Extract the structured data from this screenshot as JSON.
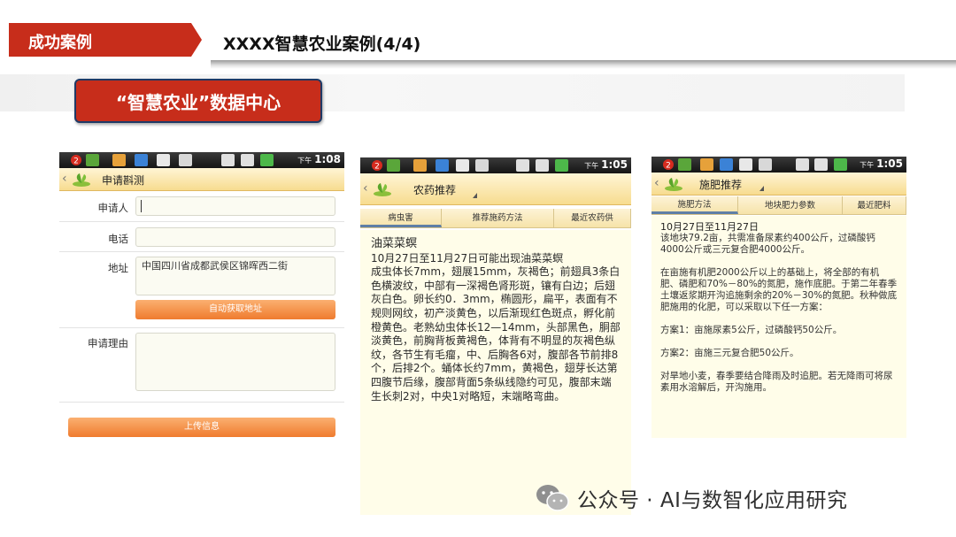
{
  "header": {
    "tag": "成功案例",
    "title": "XXXX智慧农业案例(4/4)",
    "colors": {
      "tag": "#c72d1b",
      "box_border": "#1f3a66"
    }
  },
  "data_center_label": "“智慧农业”数据中心",
  "status_bar": {
    "badge": "2",
    "am_pm": "下午",
    "time_1": "1:08",
    "time_2": "1:05",
    "time_3": "1:05"
  },
  "screen1": {
    "title": "申请斟测",
    "fields": {
      "applicant_label": "申请人",
      "applicant_value": "",
      "phone_label": "电话",
      "phone_value": "",
      "address_label": "地址",
      "address_value": "中国四川省成都武侯区锦晖西二街",
      "reason_label": "申请理由",
      "reason_value": ""
    },
    "auto_address_button": "自动获取地址",
    "upload_button": "上传信息"
  },
  "screen2": {
    "title": "农药推荐",
    "tabs": [
      "病虫害",
      "推荐施药方法",
      "最近农药供"
    ],
    "heading": "油菜菜螟",
    "content": "10月27日至11月27日可能出现油菜菜螟\n成虫体长7mm，翅展15mm，灰褐色；前翅具3条白色横波纹，中部有一深褐色肾形斑，镶有白边；后翅灰白色。卵长约0．3mm，椭圆形，扁平，表面有不规则网纹，初产淡黄色，以后渐现红色斑点，孵化前橙黄色。老熟幼虫体长12—14mm，头部黑色，胴部淡黄色，前胸背板黄褐色，体背有不明显的灰褐色纵纹，各节生有毛瘤，中、后胸各6对，腹部各节前排8个，后排2个。蛹体长约7mm，黄褐色，翅芽长达第四腹节后缘，腹部背面5条纵线隐约可见，腹部末端生长刺2对，中央1对略短，末端略弯曲。"
  },
  "screen3": {
    "title": "施肥推荐",
    "tabs": [
      "施肥方法",
      "地块肥力参数",
      "最近肥料"
    ],
    "heading": "10月27日至11月27日",
    "content": "该地块79.2亩，共需准备尿素约400公斤，过磷酸钙4000公斤或三元复合肥4000公斤。\n\n在亩施有机肥2000公斤以上的基础上，将全部的有机肥、磷肥和70%－80%的氮肥，施作底肥。于第二年春季土壤返浆期开沟追施剩余的20%－30%的氮肥。秋种做底肥施用的化肥，可以采取以下任一方案：\n\n方案1：亩施尿素5公斤，过磷酸钙50公斤。\n\n方案2：亩施三元复合肥50公斤。\n\n对旱地小麦，春季要结合降雨及时追肥。若无降雨可将尿素用水溶解后，开沟施用。"
  },
  "watermark": {
    "text": "公众号 · AI与数智化应用研究",
    "icon": "wechat-icon"
  }
}
